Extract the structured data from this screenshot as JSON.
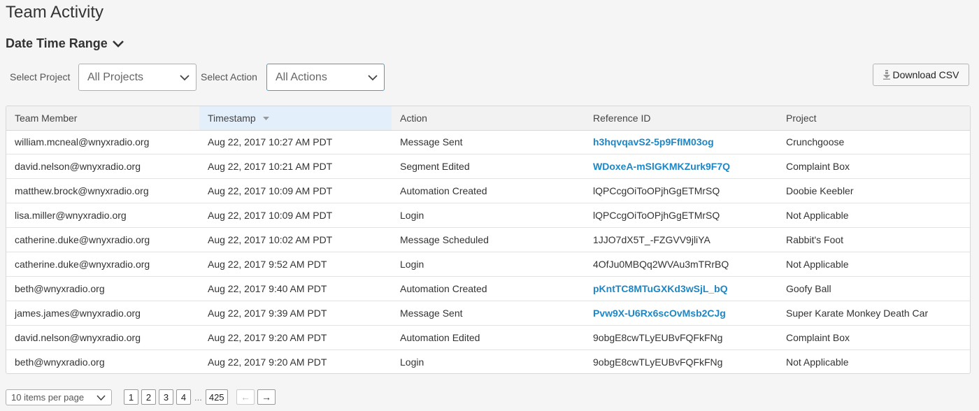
{
  "page": {
    "title": "Team Activity"
  },
  "date_range": {
    "label": "Date Time Range"
  },
  "filters": {
    "project_label": "Select Project",
    "project_value": "All Projects",
    "action_label": "Select Action",
    "action_value": "All Actions"
  },
  "toolbar": {
    "download_label": "Download CSV"
  },
  "table": {
    "headers": {
      "member": "Team Member",
      "timestamp": "Timestamp",
      "action": "Action",
      "reference": "Reference ID",
      "project": "Project"
    },
    "rows": [
      {
        "member": "william.mcneal@wnyxradio.org",
        "timestamp": "Aug 22, 2017 10:27 AM PDT",
        "action": "Message Sent",
        "reference": "h3hqvqavS2-5p9FfIM03og",
        "ref_link": true,
        "project": "Crunchgoose"
      },
      {
        "member": "david.nelson@wnyxradio.org",
        "timestamp": "Aug 22, 2017 10:21 AM PDT",
        "action": "Segment Edited",
        "reference": "WDoxeA-mSlGKMKZurk9F7Q",
        "ref_link": true,
        "project": "Complaint Box"
      },
      {
        "member": "matthew.brock@wnyxradio.org",
        "timestamp": "Aug 22, 2017 10:09 AM PDT",
        "action": "Automation Created",
        "reference": "lQPCcgOiToOPjhGgETMrSQ",
        "ref_link": false,
        "project": "Doobie Keebler"
      },
      {
        "member": "lisa.miller@wnyxradio.org",
        "timestamp": "Aug 22, 2017 10:09 AM PDT",
        "action": "Login",
        "reference": "lQPCcgOiToOPjhGgETMrSQ",
        "ref_link": false,
        "project": "Not Applicable"
      },
      {
        "member": "catherine.duke@wnyxradio.org",
        "timestamp": "Aug 22, 2017 10:02 AM PDT",
        "action": "Message Scheduled",
        "reference": "1JJO7dX5T_-FZGVV9jliYA",
        "ref_link": false,
        "project": "Rabbit's Foot"
      },
      {
        "member": "catherine.duke@wnyxradio.org",
        "timestamp": "Aug 22, 2017 9:52 AM PDT",
        "action": "Login",
        "reference": "4OfJu0MBQq2WVAu3mTRrBQ",
        "ref_link": false,
        "project": "Not Applicable"
      },
      {
        "member": "beth@wnyxradio.org",
        "timestamp": "Aug 22, 2017 9:40 AM PDT",
        "action": "Automation Created",
        "reference": "pKntTC8MTuGXKd3wSjL_bQ",
        "ref_link": true,
        "project": "Goofy Ball"
      },
      {
        "member": "james.james@wnyxradio.org",
        "timestamp": "Aug 22, 2017 9:39 AM PDT",
        "action": "Message Sent",
        "reference": "Pvw9X-U6Rx6scOvMsb2CJg",
        "ref_link": true,
        "project": "Super Karate Monkey Death Car"
      },
      {
        "member": "david.nelson@wnyxradio.org",
        "timestamp": "Aug 22, 2017 9:20 AM PDT",
        "action": "Automation Edited",
        "reference": "9obgE8cwTLyEUBvFQFkFNg",
        "ref_link": false,
        "project": "Complaint Box"
      },
      {
        "member": "beth@wnyxradio.org",
        "timestamp": "Aug 22, 2017 9:20 AM PDT",
        "action": "Login",
        "reference": "9obgE8cwTLyEUBvFQFkFNg",
        "ref_link": false,
        "project": "Not Applicable"
      }
    ]
  },
  "pagination": {
    "per_page": "10 items per page",
    "pages": [
      "1",
      "2",
      "3",
      "4"
    ],
    "ellipsis": "...",
    "last_page": "425",
    "prev": "←",
    "next": "→"
  },
  "icons": {
    "chevron": "chevron-down-icon",
    "download": "download-icon",
    "sort": "sort-down-icon"
  },
  "colors": {
    "link": "#1d87c6",
    "focus_border": "#3aa1d6",
    "sorted_header": "#e3effa"
  }
}
